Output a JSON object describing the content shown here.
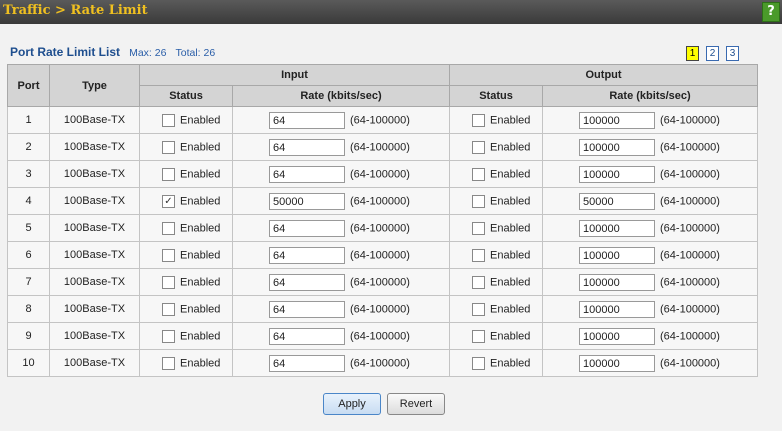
{
  "header": {
    "breadcrumb": "Traffic > Rate Limit",
    "help_label": "?"
  },
  "list": {
    "title": "Port Rate Limit List",
    "max": "Max: 26",
    "total": "Total: 26"
  },
  "pagination": {
    "pages": [
      "1",
      "2",
      "3"
    ],
    "current": "1"
  },
  "table": {
    "headers": {
      "port": "Port",
      "type": "Type",
      "input": "Input",
      "output": "Output",
      "status": "Status",
      "rate": "Rate (kbits/sec)"
    },
    "range": "(64-100000)",
    "enabled_label": "Enabled",
    "rows": [
      {
        "port": "1",
        "type": "100Base-TX",
        "in_enabled": false,
        "in_rate": "64",
        "out_enabled": false,
        "out_rate": "100000"
      },
      {
        "port": "2",
        "type": "100Base-TX",
        "in_enabled": false,
        "in_rate": "64",
        "out_enabled": false,
        "out_rate": "100000"
      },
      {
        "port": "3",
        "type": "100Base-TX",
        "in_enabled": false,
        "in_rate": "64",
        "out_enabled": false,
        "out_rate": "100000"
      },
      {
        "port": "4",
        "type": "100Base-TX",
        "in_enabled": true,
        "in_rate": "50000",
        "out_enabled": false,
        "out_rate": "50000"
      },
      {
        "port": "5",
        "type": "100Base-TX",
        "in_enabled": false,
        "in_rate": "64",
        "out_enabled": false,
        "out_rate": "100000"
      },
      {
        "port": "6",
        "type": "100Base-TX",
        "in_enabled": false,
        "in_rate": "64",
        "out_enabled": false,
        "out_rate": "100000"
      },
      {
        "port": "7",
        "type": "100Base-TX",
        "in_enabled": false,
        "in_rate": "64",
        "out_enabled": false,
        "out_rate": "100000"
      },
      {
        "port": "8",
        "type": "100Base-TX",
        "in_enabled": false,
        "in_rate": "64",
        "out_enabled": false,
        "out_rate": "100000"
      },
      {
        "port": "9",
        "type": "100Base-TX",
        "in_enabled": false,
        "in_rate": "64",
        "out_enabled": false,
        "out_rate": "100000"
      },
      {
        "port": "10",
        "type": "100Base-TX",
        "in_enabled": false,
        "in_rate": "64",
        "out_enabled": false,
        "out_rate": "100000"
      }
    ]
  },
  "buttons": {
    "apply": "Apply",
    "revert": "Revert"
  }
}
